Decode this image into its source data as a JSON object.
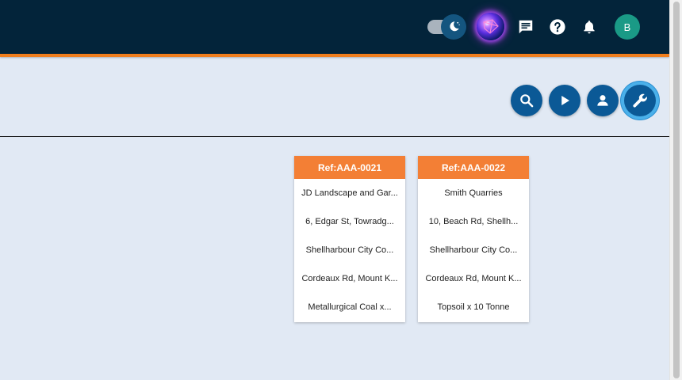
{
  "header": {
    "avatar_initial": "B",
    "accent_color": "#f07e1d",
    "background_color": "#03243a",
    "icons": [
      "moon-icon",
      "ai-assistant-icon",
      "chat-icon",
      "help-icon",
      "bell-icon"
    ]
  },
  "actions": {
    "icons": [
      "search-icon",
      "play-icon",
      "person-icon",
      "wrench-icon"
    ],
    "button_color": "#0b5996"
  },
  "cards": [
    {
      "ref": "Ref:AAA-0021",
      "rows": [
        "JD Landscape and Gar...",
        "6, Edgar St, Towradg...",
        "Shellharbour City Co...",
        "Cordeaux Rd, Mount K...",
        "Metallurgical Coal x..."
      ]
    },
    {
      "ref": "Ref:AAA-0022",
      "rows": [
        "Smith Quarries",
        "10, Beach Rd, Shellh...",
        "Shellharbour City Co...",
        "Cordeaux Rd, Mount K...",
        "Topsoil x 10 Tonne"
      ]
    }
  ],
  "card_header_color": "#f37f35"
}
